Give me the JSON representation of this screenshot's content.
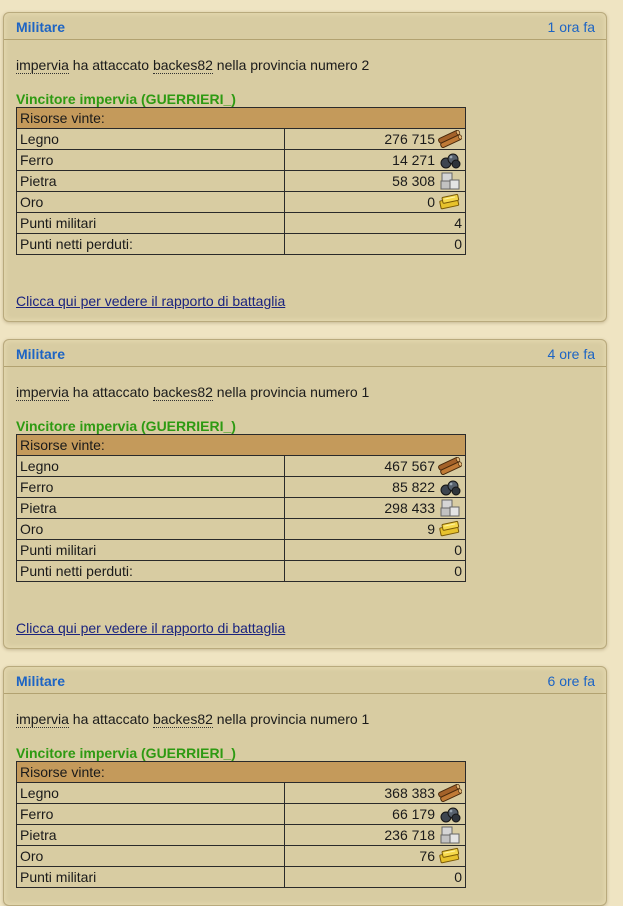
{
  "reports": [
    {
      "category": "Militare",
      "time": "1 ora fa",
      "attacker": "impervia",
      "verb": " ha attaccato ",
      "defender": "backes82",
      "province_text": " nella provincia numero 2",
      "winner": "Vincitore impervia (GUERRIERI_)",
      "resources_header": "Risorse vinte:",
      "rows": [
        {
          "label": "Legno",
          "value": "276 715",
          "icon": "wood-icon"
        },
        {
          "label": "Ferro",
          "value": "14 271",
          "icon": "iron-icon"
        },
        {
          "label": "Pietra",
          "value": "58 308",
          "icon": "stone-icon"
        },
        {
          "label": "Oro",
          "value": "0",
          "icon": "gold-icon"
        },
        {
          "label": "Punti militari",
          "value": "4",
          "icon": ""
        },
        {
          "label": "Punti netti perduti:",
          "value": "0",
          "icon": ""
        }
      ],
      "link": "Clicca qui per vedere il rapporto di battaglia"
    },
    {
      "category": "Militare",
      "time": "4 ore fa",
      "attacker": "impervia",
      "verb": " ha attaccato ",
      "defender": "backes82",
      "province_text": " nella provincia numero 1",
      "winner": "Vincitore impervia (GUERRIERI_)",
      "resources_header": "Risorse vinte:",
      "rows": [
        {
          "label": "Legno",
          "value": "467 567",
          "icon": "wood-icon"
        },
        {
          "label": "Ferro",
          "value": "85 822",
          "icon": "iron-icon"
        },
        {
          "label": "Pietra",
          "value": "298 433",
          "icon": "stone-icon"
        },
        {
          "label": "Oro",
          "value": "9",
          "icon": "gold-icon"
        },
        {
          "label": "Punti militari",
          "value": "0",
          "icon": ""
        },
        {
          "label": "Punti netti perduti:",
          "value": "0",
          "icon": ""
        }
      ],
      "link": "Clicca qui per vedere il rapporto di battaglia"
    },
    {
      "category": "Militare",
      "time": "6 ore fa",
      "attacker": "impervia",
      "verb": " ha attaccato ",
      "defender": "backes82",
      "province_text": " nella provincia numero 1",
      "winner": "Vincitore impervia (GUERRIERI_)",
      "resources_header": "Risorse vinte:",
      "rows": [
        {
          "label": "Legno",
          "value": "368 383",
          "icon": "wood-icon"
        },
        {
          "label": "Ferro",
          "value": "66 179",
          "icon": "iron-icon"
        },
        {
          "label": "Pietra",
          "value": "236 718",
          "icon": "stone-icon"
        },
        {
          "label": "Oro",
          "value": "76",
          "icon": "gold-icon"
        },
        {
          "label": "Punti militari",
          "value": "0",
          "icon": ""
        }
      ],
      "link": ""
    }
  ],
  "colors": {
    "category_text": "#1d64c4",
    "winner_text": "#2e9a12",
    "table_header_bg": "#c49a5b",
    "panel_bg": "#d8cca2",
    "link_text": "#1a237e"
  }
}
